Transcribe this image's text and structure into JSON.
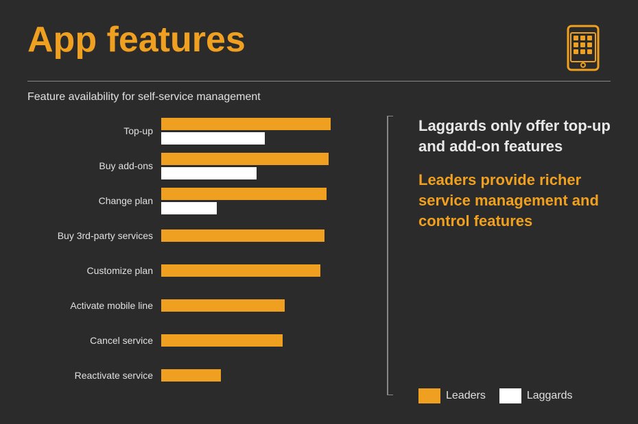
{
  "title": "App features",
  "subtitle": "Feature availability for self-service management",
  "colors": {
    "background": "#2b2b2b",
    "accent": "#f0a020",
    "leaders": "#f0a020",
    "laggards": "#ffffff",
    "text": "#e0e0e0"
  },
  "chart": {
    "rows": [
      {
        "label": "Top-up",
        "leaders": 85,
        "laggards": 52,
        "has_laggard": true
      },
      {
        "label": "Buy add-ons",
        "leaders": 84,
        "laggards": 48,
        "has_laggard": true
      },
      {
        "label": "Change plan",
        "leaders": 83,
        "laggards": 28,
        "has_laggard": true
      },
      {
        "label": "Buy 3rd-party services",
        "leaders": 82,
        "laggards": 0,
        "has_laggard": false
      },
      {
        "label": "Customize plan",
        "leaders": 80,
        "laggards": 0,
        "has_laggard": false
      },
      {
        "label": "Activate mobile line",
        "leaders": 62,
        "laggards": 0,
        "has_laggard": false
      },
      {
        "label": "Cancel service",
        "leaders": 61,
        "laggards": 0,
        "has_laggard": false
      },
      {
        "label": "Reactivate service",
        "leaders": 30,
        "laggards": 0,
        "has_laggard": false
      }
    ],
    "max_width": 100
  },
  "annotations": {
    "top": "Laggards only offer top-up and add-on features",
    "bottom": "Leaders provide richer service management and control features"
  },
  "legend": {
    "leaders_label": "Leaders",
    "laggards_label": "Laggards"
  }
}
